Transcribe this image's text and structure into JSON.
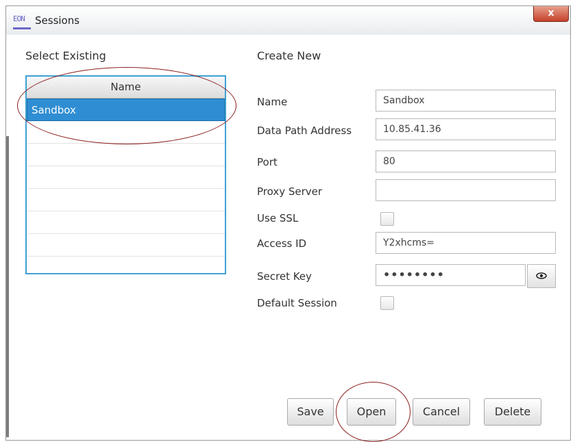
{
  "window": {
    "title": "Sessions",
    "close_label": "x",
    "logo_text": "EON"
  },
  "left": {
    "section_label": "Select Existing",
    "table": {
      "column_header": "Name",
      "rows": [
        "Sandbox",
        "",
        "",
        "",
        "",
        "",
        "",
        ""
      ],
      "selected_index": 0
    }
  },
  "right": {
    "section_label": "Create New",
    "fields": {
      "name": {
        "label": "Name",
        "value": "Sandbox"
      },
      "data_path": {
        "label": "Data Path Address",
        "value": "10.85.41.36"
      },
      "port": {
        "label": "Port",
        "value": "80"
      },
      "proxy": {
        "label": "Proxy Server",
        "value": ""
      },
      "use_ssl": {
        "label": "Use SSL",
        "checked": false
      },
      "access_id": {
        "label": "Access ID",
        "value": "Y2xhcms="
      },
      "secret_key": {
        "label": "Secret Key",
        "value": "••••••••"
      },
      "default_session": {
        "label": "Default Session",
        "checked": false
      }
    }
  },
  "buttons": {
    "save": "Save",
    "open": "Open",
    "cancel": "Cancel",
    "delete": "Delete"
  },
  "icons": {
    "eye": "eye-icon"
  },
  "colors": {
    "selection": "#2f8ed3",
    "table_border": "#3ea0d3",
    "annotation": "#8b1d1d"
  }
}
